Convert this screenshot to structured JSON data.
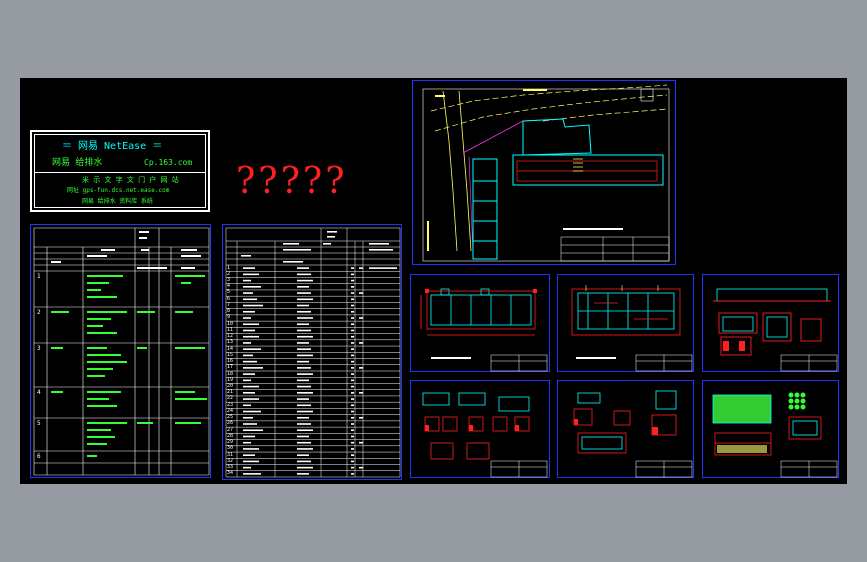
{
  "title_block": {
    "line1": "＝  网易  NetEase  ＝",
    "line2_left": "网易 给排水",
    "line2_right": "Cp.163.com",
    "line3": "米 示 文 字 文 门 户 网 站",
    "line4": "网址 gps-fun.dcs.net.ease.com",
    "line5": "网易 给排水 资料库 系统"
  },
  "question_marks": "?????",
  "materials_table": {
    "row_numbers": [
      "1",
      "2",
      "3",
      "4",
      "5",
      "6"
    ]
  },
  "parts_list": {
    "row_numbers": [
      "1",
      "2",
      "3",
      "4",
      "5",
      "6",
      "7",
      "8",
      "9",
      "10",
      "11",
      "12",
      "13",
      "14",
      "15",
      "16",
      "17",
      "18",
      "19",
      "20",
      "21",
      "22",
      "23",
      "24",
      "25",
      "26",
      "27",
      "28",
      "29",
      "30",
      "31",
      "32",
      "33",
      "34"
    ]
  },
  "colors": {
    "background": "#969ba2",
    "model_space": "#000000",
    "frame": "#2233ff",
    "table_lines": "#ffffff",
    "green_text": "#33ff33",
    "red": "#ff2020",
    "cyan": "#00ffff",
    "yellow": "#ffff66",
    "magenta": "#ff33ff"
  }
}
